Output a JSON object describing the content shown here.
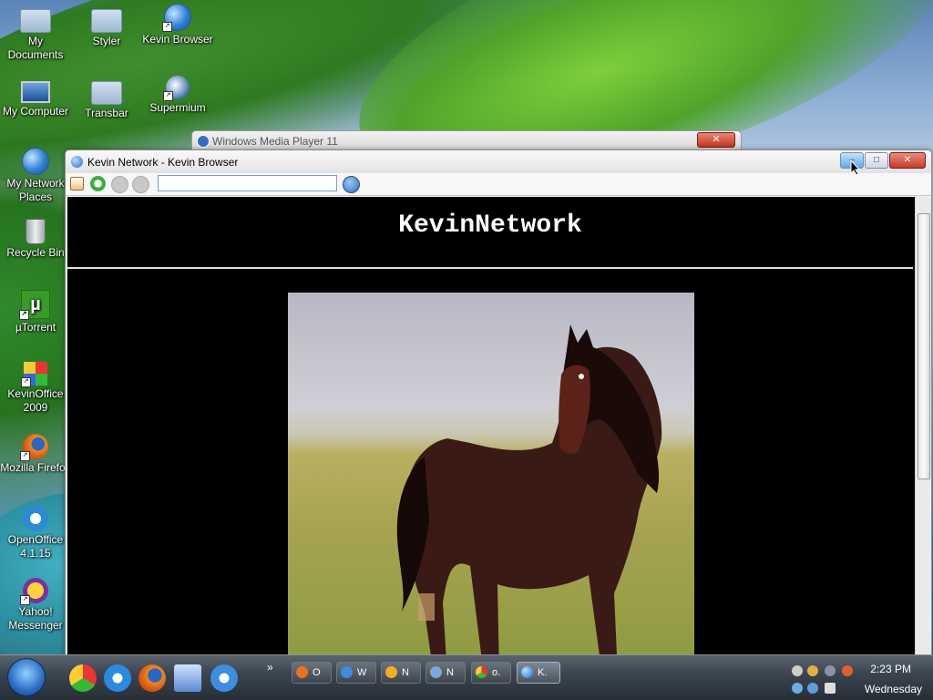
{
  "desktop": {
    "icons": [
      {
        "label": "My Documents",
        "icon": "folder-icon"
      },
      {
        "label": "Styler",
        "icon": "folder-icon"
      },
      {
        "label": "Kevin Browser",
        "icon": "globe-icon"
      },
      {
        "label": "My Computer",
        "icon": "computer-icon"
      },
      {
        "label": "Transbar",
        "icon": "folder-icon"
      },
      {
        "label": "Supermium",
        "icon": "supermium-icon"
      },
      {
        "label": "My Network Places",
        "icon": "network-icon"
      },
      {
        "label": "Recycle Bin",
        "icon": "recycle-bin-icon"
      },
      {
        "label": "µTorrent",
        "icon": "utorrent-icon"
      },
      {
        "label": "KevinOffice 2009",
        "icon": "office-icon"
      },
      {
        "label": "Mozilla Firefox",
        "icon": "firefox-icon"
      },
      {
        "label": "OpenOffice 4.1.15",
        "icon": "openoffice-icon"
      },
      {
        "label": "Yahoo! Messenger",
        "icon": "yahoo-messenger-icon"
      }
    ]
  },
  "background_window": {
    "title": "Windows Media Player 11",
    "close_glyph": "✕"
  },
  "browser": {
    "title": "Kevin Network - Kevin Browser",
    "minimize_glyph": "–",
    "maximize_glyph": "□",
    "close_glyph": "✕",
    "url_value": "",
    "page": {
      "heading": "KevinNetwork",
      "image": "horse-in-field-photo"
    }
  },
  "taskbar": {
    "quick_launch": [
      "chrome-icon",
      "ie-icon",
      "firefox-icon",
      "explorer-icon",
      "media-player-icon"
    ],
    "overflow_glyph": "»",
    "tasks": [
      {
        "label": "O",
        "icon": "firefox-icon"
      },
      {
        "label": "W",
        "icon": "media-player-icon"
      },
      {
        "label": "N",
        "icon": "winamp-icon"
      },
      {
        "label": "N",
        "icon": "supermium-icon"
      },
      {
        "label": "o.",
        "icon": "chrome-icon"
      },
      {
        "label": "K.",
        "icon": "globe-icon",
        "active": true
      }
    ],
    "clock": "2:23 PM",
    "day": "Wednesday"
  },
  "colors": {
    "taskbar": "#3b4550",
    "browser_content": "#000000",
    "close_red": "#c53a24"
  }
}
